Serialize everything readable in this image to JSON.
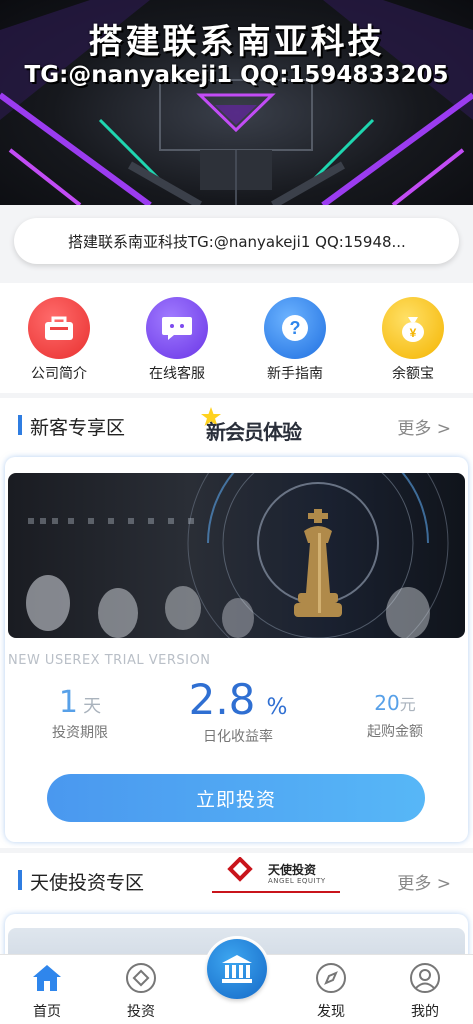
{
  "banner": {
    "title": "搭建联系南亚科技",
    "subtitle": "TG:@nanyakeji1 QQ:1594833205"
  },
  "notice": {
    "text": "搭建联系南亚科技TG:@nanyakeji1 QQ:15948..."
  },
  "quick_menu": [
    {
      "label": "公司简介",
      "icon": "briefcase-icon",
      "color": "#f04a48"
    },
    {
      "label": "在线客服",
      "icon": "chat-bubble-icon",
      "color": "#7d4bef"
    },
    {
      "label": "新手指南",
      "icon": "question-icon",
      "color": "#2f86ec"
    },
    {
      "label": "余额宝",
      "icon": "money-bag-icon",
      "color": "#f7c21c"
    }
  ],
  "section_new": {
    "title": "新客专享区",
    "badge": "新会员体验",
    "more": "更多 >"
  },
  "product": {
    "name_en": "NEW USEREX TRIAL VERSION",
    "period_value": "1",
    "period_unit": "天",
    "period_label": "投资期限",
    "rate_value": "2.8",
    "rate_unit": "%",
    "rate_label": "日化收益率",
    "min_value": "20",
    "min_unit": "元",
    "min_label": "起购金额",
    "button": "立即投资"
  },
  "section_angel": {
    "title": "天使投资专区",
    "logo_cn": "天使投资",
    "logo_en": "ANGEL EQUITY",
    "more": "更多 >"
  },
  "tabbar": [
    {
      "label": "首页",
      "icon": "home-icon",
      "active": true
    },
    {
      "label": "投资",
      "icon": "diamond-icon",
      "active": false
    },
    {
      "label": "",
      "icon": "bank-icon",
      "active": false
    },
    {
      "label": "发现",
      "icon": "compass-icon",
      "active": false
    },
    {
      "label": "我的",
      "icon": "user-icon",
      "active": false
    }
  ],
  "colors": {
    "accent": "#3473d6",
    "button_gradient_start": "#4a98ef",
    "button_gradient_end": "#57b7f7"
  }
}
